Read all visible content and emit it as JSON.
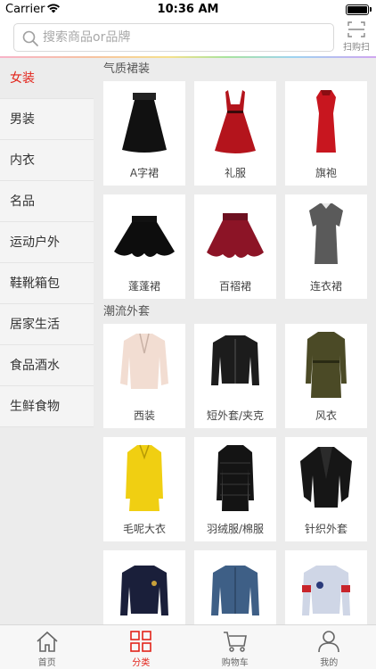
{
  "status_bar": {
    "carrier": "Carrier",
    "time": "10:36 AM"
  },
  "search": {
    "placeholder": "搜索商品or品牌",
    "scan_label": "扫购扫"
  },
  "sidebar": {
    "items": [
      {
        "label": "女装",
        "active": true
      },
      {
        "label": "男装",
        "active": false
      },
      {
        "label": "内衣",
        "active": false
      },
      {
        "label": "名品",
        "active": false
      },
      {
        "label": "运动户外",
        "active": false
      },
      {
        "label": "鞋靴箱包",
        "active": false
      },
      {
        "label": "居家生活",
        "active": false
      },
      {
        "label": "食品酒水",
        "active": false
      },
      {
        "label": "生鲜食物",
        "active": false
      }
    ]
  },
  "sections": [
    {
      "title": "气质裙装",
      "products": [
        {
          "name": "A字裙",
          "image": "a-line-skirt"
        },
        {
          "name": "礼服",
          "image": "red-evening-dress"
        },
        {
          "name": "旗袍",
          "image": "red-qipao"
        },
        {
          "name": "蓬蓬裙",
          "image": "black-puff-skirt"
        },
        {
          "name": "百褶裙",
          "image": "burgundy-pleated-skirt"
        },
        {
          "name": "连衣裙",
          "image": "gray-dress"
        }
      ]
    },
    {
      "title": "潮流外套",
      "products": [
        {
          "name": "西装",
          "image": "pink-blazer"
        },
        {
          "name": "短外套/夹克",
          "image": "black-leather-jacket"
        },
        {
          "name": "风衣",
          "image": "olive-trench-coat"
        },
        {
          "name": "毛呢大衣",
          "image": "yellow-wool-coat"
        },
        {
          "name": "羽绒服/棉服",
          "image": "black-down-coat"
        },
        {
          "name": "针织外套",
          "image": "black-knit-cardigan"
        },
        {
          "name": "",
          "image": "navy-bomber-jacket"
        },
        {
          "name": "",
          "image": "denim-jacket"
        },
        {
          "name": "",
          "image": "varsity-jacket"
        }
      ]
    }
  ],
  "tabbar": {
    "tabs": [
      {
        "label": "首页",
        "icon": "home-icon",
        "active": false
      },
      {
        "label": "分类",
        "icon": "category-grid-icon",
        "active": true
      },
      {
        "label": "购物车",
        "icon": "cart-icon",
        "active": false
      },
      {
        "label": "我的",
        "icon": "profile-icon",
        "active": false
      }
    ]
  },
  "colors": {
    "accent": "#e2231a",
    "sidebar_bg": "#f4f4f4",
    "content_bg": "#ececec"
  }
}
